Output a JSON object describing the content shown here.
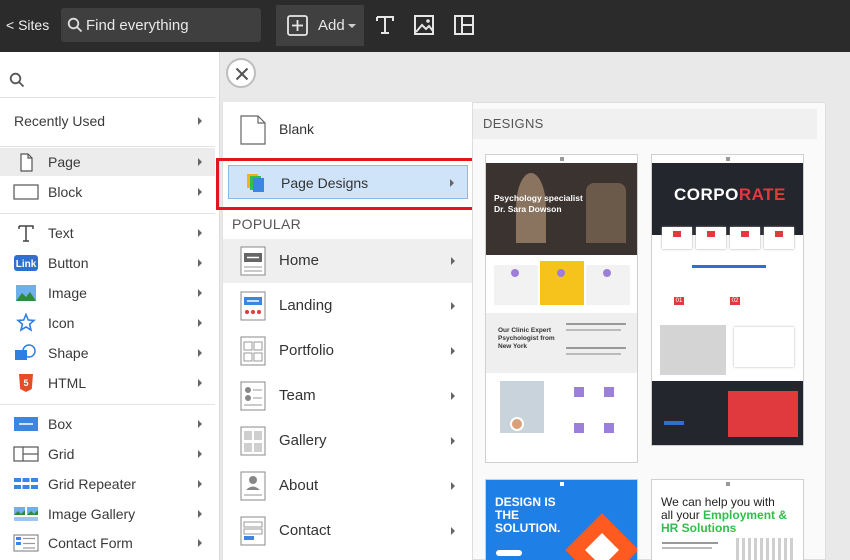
{
  "topbar": {
    "back_label": "< Sites",
    "search_placeholder": "Find everything",
    "add_label": "Add"
  },
  "sidebar": {
    "recent_label": "Recently Used",
    "items": [
      {
        "label": "Page",
        "icon": "page-icon"
      },
      {
        "label": "Block",
        "icon": "block-icon"
      },
      {
        "label": "Text",
        "icon": "text-icon"
      },
      {
        "label": "Button",
        "icon": "link-icon"
      },
      {
        "label": "Image",
        "icon": "image-icon"
      },
      {
        "label": "Icon",
        "icon": "star-icon"
      },
      {
        "label": "Shape",
        "icon": "shape-icon"
      },
      {
        "label": "HTML",
        "icon": "html5-icon"
      },
      {
        "label": "Box",
        "icon": "box-icon"
      },
      {
        "label": "Grid",
        "icon": "grid-icon"
      },
      {
        "label": "Grid Repeater",
        "icon": "grid-repeater-icon"
      },
      {
        "label": "Image Gallery",
        "icon": "image-gallery-icon"
      },
      {
        "label": "Contact Form",
        "icon": "contact-form-icon"
      }
    ],
    "link_badge": "Link",
    "html_badge": "5"
  },
  "menu": {
    "blank_label": "Blank",
    "page_designs_label": "Page Designs",
    "popular_label": "POPULAR",
    "items": [
      {
        "label": "Home"
      },
      {
        "label": "Landing"
      },
      {
        "label": "Portfolio"
      },
      {
        "label": "Team"
      },
      {
        "label": "Gallery"
      },
      {
        "label": "About"
      },
      {
        "label": "Contact"
      }
    ]
  },
  "designs": {
    "header": "DESIGNS",
    "cards": [
      {
        "headline": "Psychology specialist",
        "subhead": "Dr. Sara Dowson",
        "section": "Our Clinic Expert Psychologist from New York"
      },
      {
        "headline_a": "CORPO",
        "headline_b": "RATE",
        "numbers": [
          "01",
          "02"
        ]
      },
      {
        "line1": "DESIGN IS",
        "line2": "THE",
        "line3": "SOLUTION."
      },
      {
        "line1": "We can help you with",
        "line2": "all your",
        "accent": "Employment &",
        "accent2": "HR Solutions"
      }
    ]
  },
  "colors": {
    "accent_blue": "#2f6fd0",
    "highlight_red": "#e3151d",
    "corporate_red": "#e03a3e",
    "design_blue": "#1e7fe6",
    "hr_green": "#2fbf4a"
  }
}
